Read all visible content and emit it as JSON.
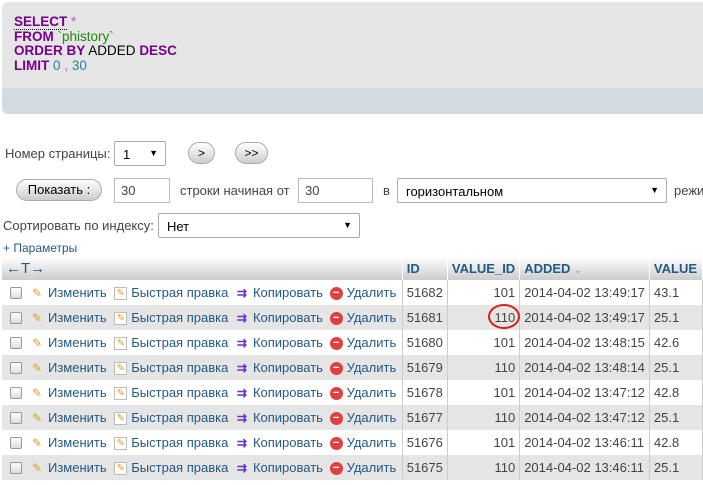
{
  "sql": {
    "select": "SELECT",
    "star": "*",
    "from": "FROM",
    "table": "`phistory`",
    "order_by": "ORDER BY",
    "column": "ADDED",
    "desc": "DESC",
    "limit": "LIMIT",
    "offset": "0",
    "comma": ",",
    "count": "30"
  },
  "nav": {
    "page_label": "Номер страницы:",
    "page_value": "1",
    "next": ">",
    "last": ">>"
  },
  "show": {
    "button": "Показать :",
    "rows_value": "30",
    "rows_label": "строки начиная от",
    "start_value": "30",
    "in_label": "в",
    "mode_value": "горизонтальном",
    "mode_suffix": "режи"
  },
  "sort": {
    "label": "Сортировать по индексу:",
    "value": "Нет"
  },
  "options_link": "+ Параметры",
  "table": {
    "headers": {
      "arrows": "←T→",
      "id": "ID",
      "value_id": "VALUE_ID",
      "added": "ADDED",
      "sort_icon": "⌄",
      "value": "VALUE"
    },
    "actions": {
      "edit": "Изменить",
      "quick_edit": "Быстрая правка",
      "copy": "Копировать",
      "delete": "Удалить"
    },
    "rows": [
      {
        "id": "51682",
        "value_id": "101",
        "added": "2014-04-02 13:49:17",
        "value": "43.1"
      },
      {
        "id": "51681",
        "value_id": "110",
        "added": "2014-04-02 13:49:17",
        "value": "25.1"
      },
      {
        "id": "51680",
        "value_id": "101",
        "added": "2014-04-02 13:48:15",
        "value": "42.6"
      },
      {
        "id": "51679",
        "value_id": "110",
        "added": "2014-04-02 13:48:14",
        "value": "25.1"
      },
      {
        "id": "51678",
        "value_id": "101",
        "added": "2014-04-02 13:47:12",
        "value": "42.8"
      },
      {
        "id": "51677",
        "value_id": "110",
        "added": "2014-04-02 13:47:12",
        "value": "25.1"
      },
      {
        "id": "51676",
        "value_id": "101",
        "added": "2014-04-02 13:46:11",
        "value": "42.8"
      },
      {
        "id": "51675",
        "value_id": "110",
        "added": "2014-04-02 13:46:11",
        "value": "25.1"
      }
    ]
  },
  "colors": {
    "keyword": "#770088",
    "link": "#235a81",
    "highlight_circle": "#d42020"
  }
}
